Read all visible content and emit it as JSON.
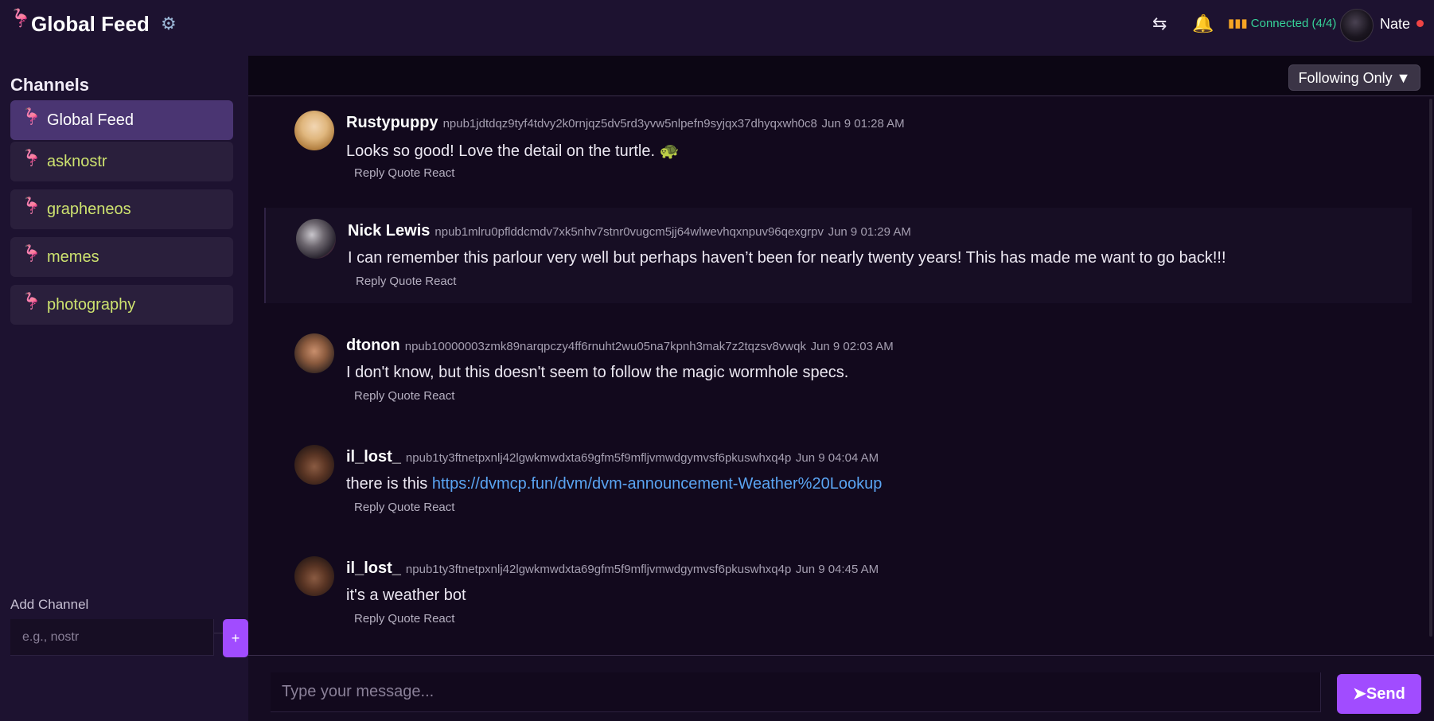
{
  "header": {
    "logo_icon": "stork-icon",
    "title": "Global Feed",
    "settings_icon": "gear-icon",
    "swap_icon": "swap-icon",
    "bell_icon": "bell-icon",
    "connection_status": "Connected (4/4)",
    "user_name": "Nate",
    "status_color": "#ef4444"
  },
  "sidebar": {
    "title": "Channels",
    "channels": [
      {
        "label": "Global Feed",
        "active": true
      },
      {
        "label": "asknostr"
      },
      {
        "label": "grapheneos"
      },
      {
        "label": "memes"
      },
      {
        "label": "photography"
      }
    ],
    "add_label": "Add Channel",
    "add_placeholder": "e.g., nostr",
    "add_button": "+"
  },
  "feed": {
    "filter": "Following Only ▼",
    "messages": [
      {
        "name": "Rustypuppy",
        "npub": "npub1jdtdqz9tyf4tdvy2k0rnjqz5dv5rd3yvw5nlpefn9syjqx37dhyqxwh0c8",
        "time": "Jun 9 01:28 AM",
        "text": "Looks so good! Love the detail on the turtle. 🐢",
        "link": ""
      },
      {
        "name": "Nick Lewis",
        "npub": "npub1mlru0pflddcmdv7xk5nhv7stnr0vugcm5jj64wlwevhqxnpuv96qexgrpv",
        "time": "Jun 9 01:29 AM",
        "text": "I can remember this parlour very well but perhaps haven’t been for nearly twenty years! This has made me want to go back!!!",
        "link": ""
      },
      {
        "name": "dtonon",
        "npub": "npub10000003zmk89narqpczy4ff6rnuht2wu05na7kpnh3mak7z2tqzsv8vwqk",
        "time": "Jun 9 02:03 AM",
        "text": "I don't know, but this doesn't seem to follow the magic wormhole specs.",
        "link": ""
      },
      {
        "name": "il_lost_",
        "npub": "npub1ty3ftnetpxnlj42lgwkmwdxta69gfm5f9mfljvmwdgymvsf6pkuswhxq4p",
        "time": "Jun 9 04:04 AM",
        "text": "there is this ",
        "link": "https://dvmcp.fun/dvm/dvm-announcement-Weather%20Lookup"
      },
      {
        "name": "il_lost_",
        "npub": "npub1ty3ftnetpxnlj42lgwkmwdxta69gfm5f9mfljvmwdgymvsf6pkuswhxq4p",
        "time": "Jun 9 04:45 AM",
        "text": "it's a weather bot",
        "link": ""
      }
    ],
    "actions": {
      "reply": "Reply",
      "quote": "Quote",
      "react": "React"
    }
  },
  "compose": {
    "placeholder": "Type your message...",
    "send_label": "➤Send"
  },
  "colors": {
    "accent": "#a14cff",
    "channel_text": "#cde26f",
    "link": "#5aa4f2",
    "connected": "#36d399"
  }
}
